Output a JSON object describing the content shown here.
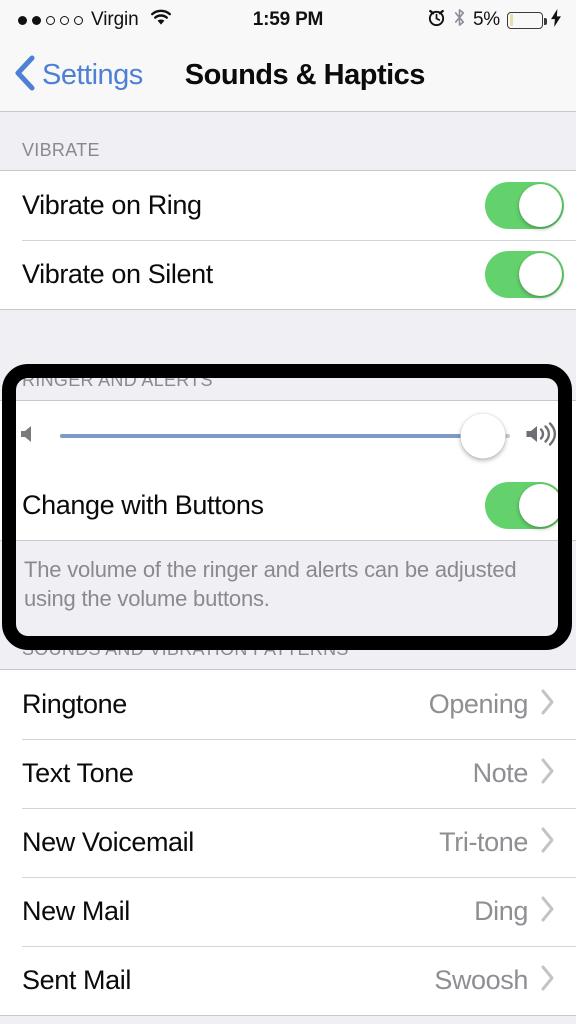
{
  "status_bar": {
    "signal_dots_filled": 2,
    "signal_dots_total": 5,
    "carrier": "Virgin",
    "wifi_icon": "wifi-icon",
    "time": "1:59 PM",
    "alarm_icon": "alarm-clock-icon",
    "bluetooth_icon": "bluetooth-icon",
    "battery_percent": "5%",
    "battery_charging": true,
    "charging_icon": "lightning-bolt-icon"
  },
  "nav_bar": {
    "back_icon": "chevron-left-icon",
    "back_label": "Settings",
    "title": "Sounds & Haptics"
  },
  "sections": {
    "vibrate": {
      "header": "VIBRATE",
      "rows": [
        {
          "label": "Vibrate on Ring",
          "toggle": "on"
        },
        {
          "label": "Vibrate on Silent",
          "toggle": "on"
        }
      ]
    },
    "ringer": {
      "header": "RINGER AND ALERTS",
      "slider": {
        "left_icon": "speaker-low-icon",
        "right_icon": "speaker-high-icon",
        "value_percent": 94
      },
      "rows": [
        {
          "label": "Change with Buttons",
          "toggle": "on"
        }
      ],
      "footer": "The volume of the ringer and alerts can be adjusted using the volume buttons."
    },
    "sounds": {
      "header": "SOUNDS AND VIBRATION PATTERNS",
      "rows": [
        {
          "label": "Ringtone",
          "value": "Opening"
        },
        {
          "label": "Text Tone",
          "value": "Note"
        },
        {
          "label": "New Voicemail",
          "value": "Tri-tone"
        },
        {
          "label": "New Mail",
          "value": "Ding"
        },
        {
          "label": "Sent Mail",
          "value": "Swoosh"
        }
      ]
    }
  },
  "annotation": {
    "type": "highlight-rectangle",
    "color": "#000000",
    "target": "RINGER AND ALERTS"
  },
  "colors": {
    "accent_blue": "#4E80D6",
    "toggle_green": "#63D26C",
    "slider_blue": "#7E9BC8",
    "list_bg": "#FFFFFF",
    "page_bg": "#EFEFF4",
    "value_gray": "#8E8E93",
    "header_gray": "#8A8A8E"
  }
}
